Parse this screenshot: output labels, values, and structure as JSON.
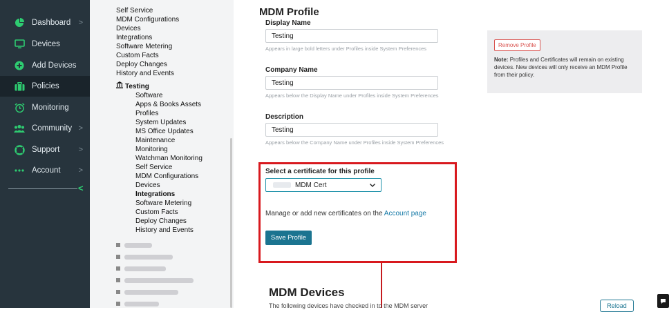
{
  "sidebar": {
    "items": [
      {
        "label": "Dashboard",
        "icon": "pie-chart-icon",
        "chevron": true
      },
      {
        "label": "Devices",
        "icon": "monitor-icon",
        "chevron": false
      },
      {
        "label": "Add Devices",
        "icon": "plus-circle-icon",
        "chevron": false
      },
      {
        "label": "Policies",
        "icon": "briefcase-icon",
        "chevron": false,
        "active": true
      },
      {
        "label": "Monitoring",
        "icon": "alarm-clock-icon",
        "chevron": false
      },
      {
        "label": "Community",
        "icon": "users-icon",
        "chevron": true
      },
      {
        "label": "Support",
        "icon": "lifebuoy-icon",
        "chevron": true
      },
      {
        "label": "Account",
        "icon": "ellipsis-icon",
        "chevron": true
      }
    ],
    "chevron_glyph": ">",
    "collapse_glyph": "<",
    "accent_color": "#2ecc71"
  },
  "tree": {
    "top_items": [
      "Self Service",
      "MDM Configurations",
      "Devices",
      "Integrations",
      "Software Metering",
      "Custom Facts",
      "Deploy Changes",
      "History and Events"
    ],
    "policy_name": "Testing",
    "policy_items": [
      "Software",
      "Apps & Books Assets",
      "Profiles",
      "System Updates",
      "MS Office Updates",
      "Maintenance",
      "Monitoring",
      "Watchman Monitoring",
      "Self Service",
      "MDM Configurations",
      "Devices",
      "Integrations",
      "Software Metering",
      "Custom Facts",
      "Deploy Changes",
      "History and Events"
    ]
  },
  "main": {
    "title": "MDM Profile",
    "display_name": {
      "label": "Display Name",
      "value": "Testing",
      "help": "Appears in large bold letters under Profiles inside System Preferences"
    },
    "company_name": {
      "label": "Company Name",
      "value": "Testing",
      "help": "Appears below the Display Name under Profiles inside System Preferences"
    },
    "description": {
      "label": "Description",
      "value": "Testing",
      "help": "Appears below the Company Name under Profiles inside System Preferences"
    },
    "certificate": {
      "label": "Select a certificate for this profile",
      "selected": "MDM Cert",
      "caret": "⌄",
      "manage_text": "Manage or add new certificates on the",
      "manage_link": "Account page"
    },
    "save_label": "Save Profile",
    "remove_label": "Remove Profile",
    "note_label": "Note:",
    "note_text": "Profiles and Certificates will remain on existing devices. New devices will only receive an MDM Profile from their policy.",
    "devices_title": "MDM Devices",
    "devices_text": "The following devices have checked in to the MDM server",
    "reload_label": "Reload",
    "highlight_color": "#d8191e",
    "primary_color": "#1b7490"
  }
}
